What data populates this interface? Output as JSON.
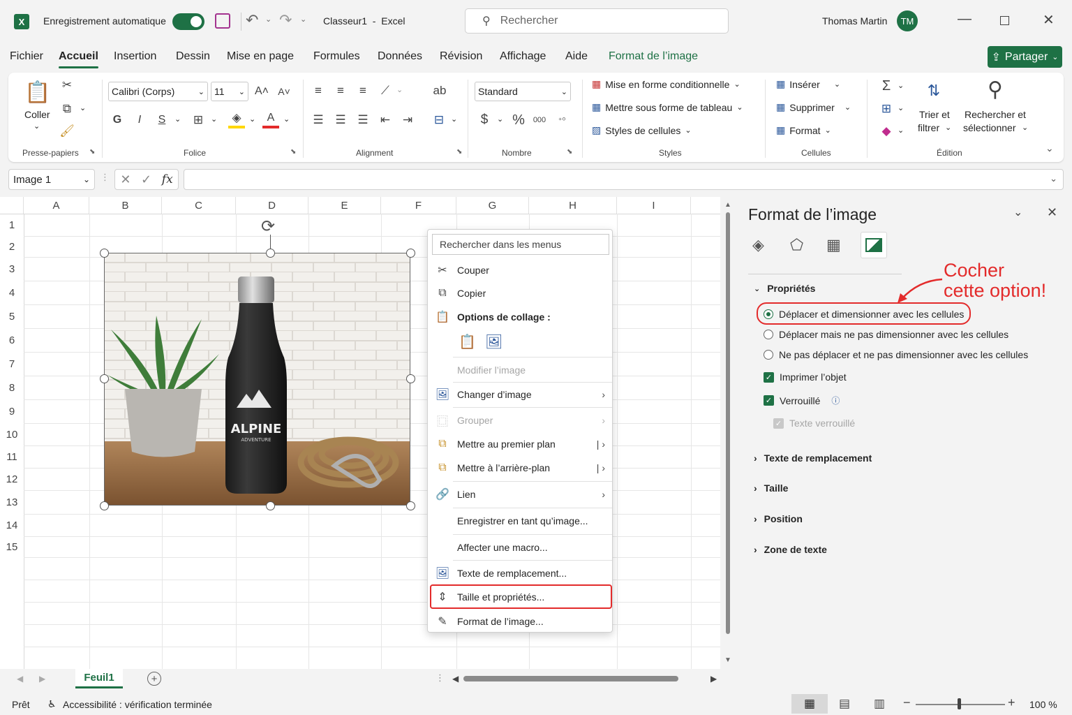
{
  "titlebar": {
    "autosave_label": "Enregistrement automatique",
    "doc_title": "Classeur1  -  Excel",
    "search_placeholder": "Rechercher",
    "user_name": "Thomas Martin",
    "user_initials": "TM"
  },
  "tabs": [
    "Fichier",
    "Accueil",
    "Insertion",
    "Dessin",
    "Mise en page",
    "Formules",
    "Données",
    "Révision",
    "Affichage",
    "Aide",
    "Format de l’image"
  ],
  "share_label": "Partager",
  "ribbon": {
    "paste_label": "Coller",
    "clipboard_label": "Presse-papiers",
    "font_name": "Calibri (Corps)",
    "font_size": "11",
    "font_group_label": "Folice",
    "bold": "G",
    "italic": "I",
    "underline": "S",
    "alignment_label": "Alignment",
    "number_format": "Standard",
    "number_label": "Nombre",
    "cond_format": "Mise en forme conditionnelle",
    "table_format": "Mettre sous forme de tableau",
    "cell_styles": "Styles de cellules",
    "styles_label": "Styles",
    "insert": "Insérer",
    "delete": "Supprimer",
    "format": "Format",
    "cells_label": "Cellules",
    "sort_filter_1": "Trier et",
    "sort_filter_2": "filtrer",
    "find_select_1": "Rechercher et",
    "find_select_2": "sélectionner",
    "editing_label": "Édition"
  },
  "formula_bar": {
    "name_box": "Image 1",
    "fx": "fx"
  },
  "grid": {
    "columns": [
      "A",
      "B",
      "C",
      "D",
      "E",
      "F",
      "G",
      "H",
      "I"
    ],
    "rows": [
      "1",
      "2",
      "3",
      "4",
      "5",
      "6",
      "7",
      "8",
      "9",
      "10",
      "11",
      "12",
      "13",
      "14",
      "15"
    ]
  },
  "image": {
    "brand": "ALPINE",
    "sub": "ADVENTURE"
  },
  "context_menu": {
    "search": "Rechercher dans les menus",
    "cut": "Couper",
    "copy": "Copier",
    "paste_options": "Options de collage :",
    "edit_image": "Modifier l’image",
    "change_image": "Changer d’image",
    "group": "Grouper",
    "bring_front": "Mettre au premier plan",
    "send_back": "Mettre à l’arrière-plan",
    "link": "Lien",
    "save_as_image": "Enregistrer en tant qu’image...",
    "assign_macro": "Affecter une macro...",
    "alt_text": "Texte de remplacement...",
    "size_props": "Taille et propriétés...",
    "format_image": "Format de l’image..."
  },
  "pane": {
    "title": "Format de l’image",
    "properties": "Propriétés",
    "opt1": "Déplacer et dimensionner avec les cellules",
    "opt2": "Déplacer mais ne pas dimensionner avec les cellules",
    "opt3": "Ne pas déplacer et ne pas dimensionner avec les cellules",
    "print_object": "Imprimer l’objet",
    "locked": "Verrouillé",
    "lock_text": "Texte verrouillé",
    "alt_text": "Texte de remplacement",
    "size": "Taille",
    "position": "Position",
    "text_box": "Zone de texte",
    "annotation_1": "Cocher",
    "annotation_2": "cette option!"
  },
  "sheet_tab": "Feuil1",
  "status": {
    "ready": "Prêt",
    "accessibility": "Accessibilité : vérification terminée",
    "zoom": "100 %"
  },
  "colors": {
    "accent": "#1e7145",
    "annotation": "#e32b2b"
  }
}
